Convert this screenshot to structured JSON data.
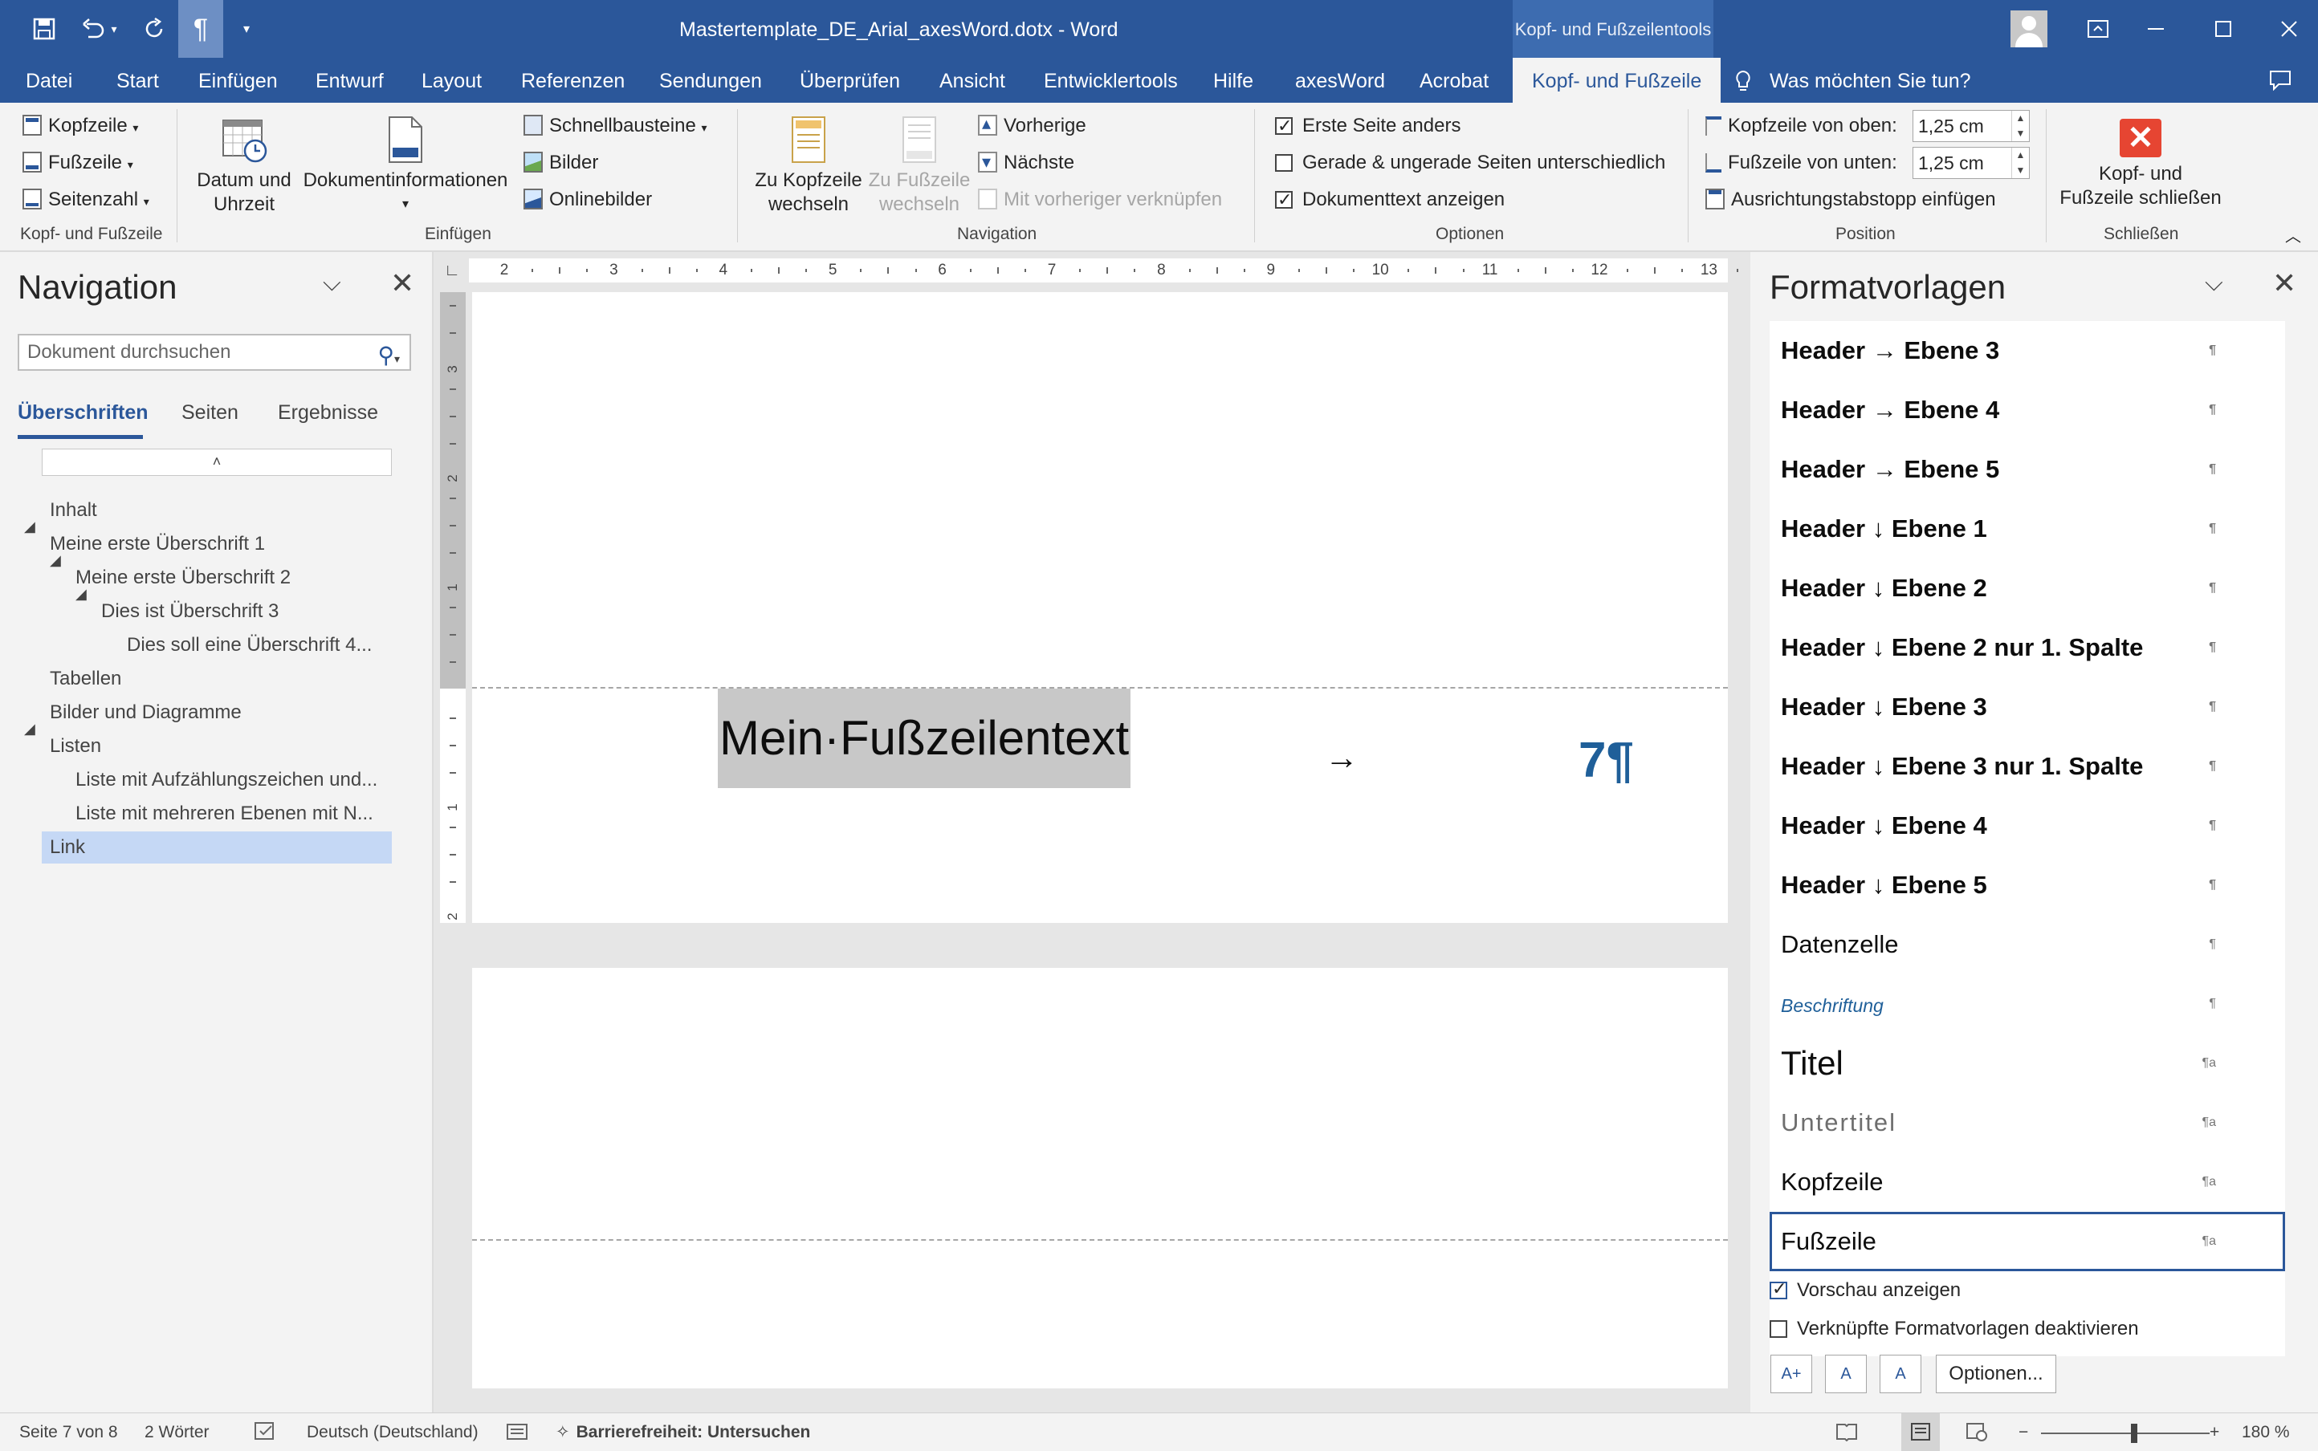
{
  "titlebar": {
    "doc_title": "Mastertemplate_DE_Arial_axesWord.dotx  -  Word",
    "contextual_group": "Kopf- und Fußzeilentools"
  },
  "menu": {
    "tabs": [
      "Datei",
      "Start",
      "Einfügen",
      "Entwurf",
      "Layout",
      "Referenzen",
      "Sendungen",
      "Überprüfen",
      "Ansicht",
      "Entwicklertools",
      "Hilfe",
      "axesWord",
      "Acrobat",
      "Kopf- und Fußzeile"
    ],
    "active": "Kopf- und Fußzeile",
    "tell_me": "Was möchten Sie tun?"
  },
  "ribbon": {
    "kopf_fusszeile": {
      "kopfzeile": "Kopfzeile",
      "fusszeile": "Fußzeile",
      "seitenzahl": "Seitenzahl",
      "label": "Kopf- und Fußzeile"
    },
    "einfuegen": {
      "datum_1": "Datum und",
      "datum_2": "Uhrzeit",
      "dokinfo": "Dokumentinformationen",
      "schnellbausteine": "Schnellbausteine",
      "bilder": "Bilder",
      "onlinebilder": "Onlinebilder",
      "label": "Einfügen"
    },
    "navigation": {
      "zu_kopf_1": "Zu Kopfzeile",
      "zu_kopf_2": "wechseln",
      "zu_fuss_1": "Zu Fußzeile",
      "zu_fuss_2": "wechseln",
      "vorherige": "Vorherige",
      "naechste": "Nächste",
      "verknuepfen": "Mit vorheriger verknüpfen",
      "label": "Navigation"
    },
    "optionen": {
      "erste_seite": "Erste Seite anders",
      "gerade_ungerade": "Gerade & ungerade Seiten unterschiedlich",
      "dokumenttext": "Dokumenttext anzeigen",
      "erste_seite_checked": true,
      "gerade_ungerade_checked": false,
      "dokumenttext_checked": true,
      "label": "Optionen"
    },
    "position": {
      "kopf_oben_label": "Kopfzeile von oben:",
      "kopf_oben_value": "1,25 cm",
      "fuss_unten_label": "Fußzeile von unten:",
      "fuss_unten_value": "1,25 cm",
      "tabstopp": "Ausrichtungstabstopp einfügen",
      "label": "Position"
    },
    "schliessen": {
      "line1": "Kopf- und",
      "line2": "Fußzeile schließen",
      "label": "Schließen"
    }
  },
  "navigation_pane": {
    "title": "Navigation",
    "search_placeholder": "Dokument durchsuchen",
    "tabs": [
      "Überschriften",
      "Seiten",
      "Ergebnisse"
    ],
    "active_tab": "Überschriften",
    "scroll_marker": "˄",
    "items": [
      {
        "label": "Inhalt"
      },
      {
        "label": "Meine erste Überschrift 1"
      },
      {
        "label": "Meine erste Überschrift 2"
      },
      {
        "label": "Dies ist Überschrift 3"
      },
      {
        "label": "Dies soll eine Überschrift 4..."
      },
      {
        "label": "Tabellen"
      },
      {
        "label": "Bilder und Diagramme"
      },
      {
        "label": "Listen"
      },
      {
        "label": "Liste mit Aufzählungszeichen  und..."
      },
      {
        "label": "Liste mit mehreren Ebenen  mit N..."
      },
      {
        "label": "Link"
      }
    ],
    "selected": "Link"
  },
  "ruler": {
    "h_labels": [
      "2",
      "3",
      "4",
      "5",
      "6",
      "7",
      "8",
      "9",
      "10",
      "11",
      "12",
      "13"
    ],
    "v_labels_top": [
      "3",
      "2",
      "1"
    ],
    "v_labels_bottom": [
      "1",
      "2"
    ]
  },
  "document": {
    "footer_text": "Mein·Fußzeilentext",
    "footer_arrow": "→",
    "footer_page_number": "7¶"
  },
  "styles_pane": {
    "title": "Formatvorlagen",
    "items": [
      {
        "label": "Header → Ebene 3",
        "mark": "¶"
      },
      {
        "label": "Header → Ebene 4",
        "mark": "¶"
      },
      {
        "label": "Header → Ebene 5",
        "mark": "¶"
      },
      {
        "label": "Header ↓ Ebene 1",
        "mark": "¶"
      },
      {
        "label": "Header ↓ Ebene 2",
        "mark": "¶"
      },
      {
        "label": "Header ↓ Ebene 2 nur 1. Spalte",
        "mark": "¶"
      },
      {
        "label": "Header ↓ Ebene 3",
        "mark": "¶"
      },
      {
        "label": "Header ↓ Ebene 3 nur 1. Spalte",
        "mark": "¶"
      },
      {
        "label": "Header ↓ Ebene 4",
        "mark": "¶"
      },
      {
        "label": "Header ↓ Ebene 5",
        "mark": "¶"
      },
      {
        "label": "Datenzelle",
        "mark": "¶"
      },
      {
        "label": "Beschriftung",
        "mark": "¶"
      },
      {
        "label": "Titel",
        "mark": "¶a"
      },
      {
        "label": "Untertitel",
        "mark": "¶a"
      },
      {
        "label": "Kopfzeile",
        "mark": "¶a"
      },
      {
        "label": "Fußzeile",
        "mark": "¶a"
      }
    ],
    "selected": "Fußzeile",
    "vorschau": "Vorschau anzeigen",
    "vorschau_checked": true,
    "verknuepfte": "Verknüpfte Formatvorlagen deaktivieren",
    "verknuepfte_checked": false,
    "button_new": "A+",
    "button_inspect": "A",
    "button_manage": "A",
    "optionen": "Optionen..."
  },
  "statusbar": {
    "page": "Seite 7 von 8",
    "words": "2 Wörter",
    "language": "Deutsch (Deutschland)",
    "accessibility": "Barrierefreiheit: Untersuchen",
    "zoom": "180 %",
    "zoom_minus": "−",
    "zoom_plus": "+"
  },
  "colors": {
    "brand": "#2b579a",
    "ribbon_bg": "#f3f3f3",
    "footer_number": "#1f5f99",
    "close_red": "#e64532"
  }
}
